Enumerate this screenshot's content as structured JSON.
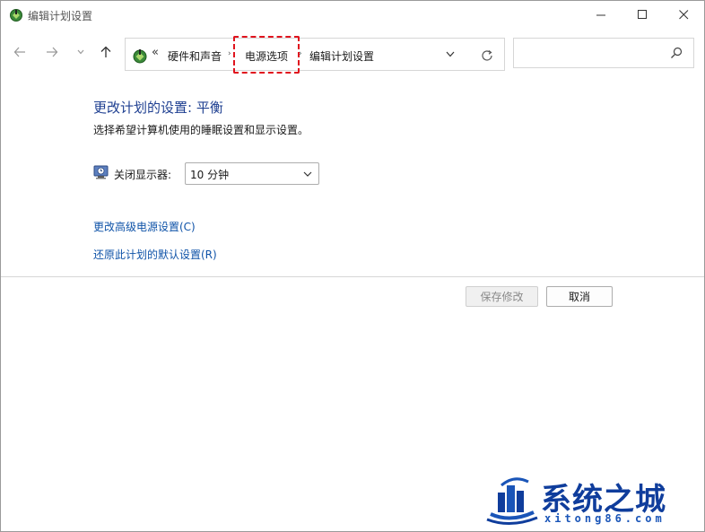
{
  "window": {
    "title": "编辑计划设置"
  },
  "address": {
    "overflow": "«",
    "crumbs": [
      "硬件和声音",
      "电源选项",
      "编辑计划设置"
    ],
    "separator": "›"
  },
  "search": {
    "placeholder": ""
  },
  "content": {
    "heading": "更改计划的设置: 平衡",
    "description": "选择希望计算机使用的睡眠设置和显示设置。",
    "display_label": "关闭显示器:",
    "display_value": "10 分钟",
    "link_advanced": "更改高级电源设置(C)",
    "link_restore": "还原此计划的默认设置(R)"
  },
  "buttons": {
    "save": "保存修改",
    "cancel": "取消"
  },
  "watermark": {
    "title": "系统之城",
    "subtitle": "xitong86.com"
  },
  "colors": {
    "heading": "#1e3f91",
    "link": "#0f53a8",
    "highlight": "#e0141e",
    "watermark": "#0f3d9c"
  }
}
